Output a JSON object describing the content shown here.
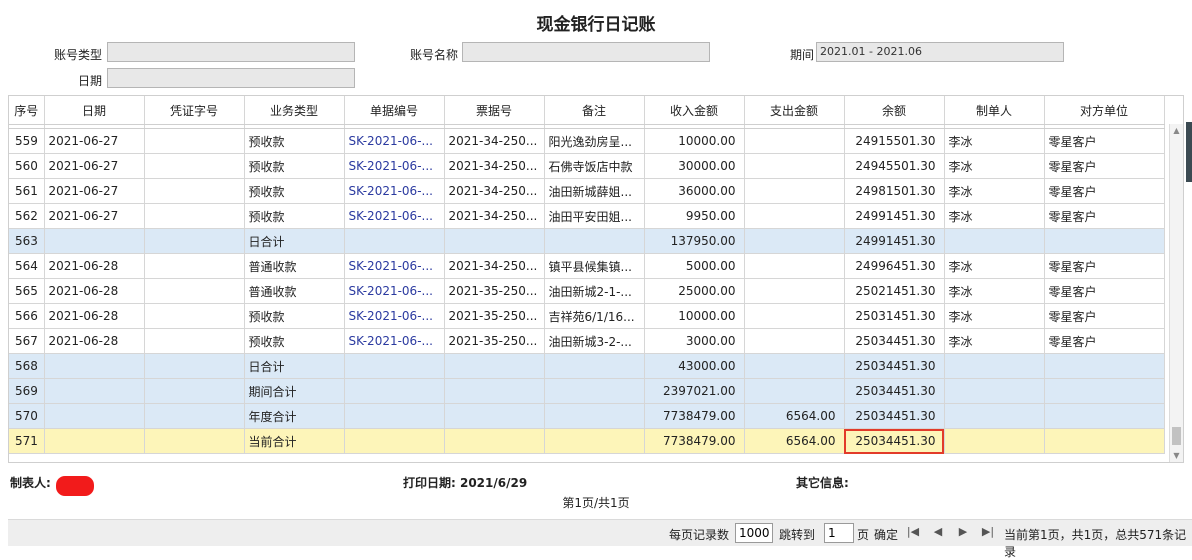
{
  "title": "现金银行日记账",
  "form": {
    "account_type_label": "账号类型",
    "account_type_value": "",
    "account_name_label": "账号名称",
    "account_name_value": "",
    "period_label": "期间",
    "period_value": "2021.01 - 2021.06",
    "date_label": "日期",
    "date_value": ""
  },
  "table": {
    "columns": [
      "序号",
      "日期",
      "凭证字号",
      "业务类型",
      "单据编号",
      "票据号",
      "备注",
      "收入金额",
      "支出金额",
      "余额",
      "制单人",
      "对方单位"
    ],
    "rows": [
      {
        "idx": "559",
        "date": "2021-06-27",
        "voucher": "",
        "biz": "预收款",
        "code": "SK-2021-06-...",
        "bill": "2021-34-250...",
        "note": "阳光逸劲房呈...",
        "income": "10000.00",
        "expense": "",
        "balance": "24915501.30",
        "maker": "李冰",
        "party": "零星客户",
        "type": "normal"
      },
      {
        "idx": "560",
        "date": "2021-06-27",
        "voucher": "",
        "biz": "预收款",
        "code": "SK-2021-06-...",
        "bill": "2021-34-250...",
        "note": "石佛寺饭店中款",
        "income": "30000.00",
        "expense": "",
        "balance": "24945501.30",
        "maker": "李冰",
        "party": "零星客户",
        "type": "normal"
      },
      {
        "idx": "561",
        "date": "2021-06-27",
        "voucher": "",
        "biz": "预收款",
        "code": "SK-2021-06-...",
        "bill": "2021-34-250...",
        "note": "油田新城薛姐...",
        "income": "36000.00",
        "expense": "",
        "balance": "24981501.30",
        "maker": "李冰",
        "party": "零星客户",
        "type": "normal"
      },
      {
        "idx": "562",
        "date": "2021-06-27",
        "voucher": "",
        "biz": "预收款",
        "code": "SK-2021-06-...",
        "bill": "2021-34-250...",
        "note": "油田平安田姐...",
        "income": "9950.00",
        "expense": "",
        "balance": "24991451.30",
        "maker": "李冰",
        "party": "零星客户",
        "type": "normal"
      },
      {
        "idx": "563",
        "date": "",
        "voucher": "",
        "biz": "日合计",
        "code": "",
        "bill": "",
        "note": "",
        "income": "137950.00",
        "expense": "",
        "balance": "24991451.30",
        "maker": "",
        "party": "",
        "type": "sum"
      },
      {
        "idx": "564",
        "date": "2021-06-28",
        "voucher": "",
        "biz": "普通收款",
        "code": "SK-2021-06-...",
        "bill": "2021-34-250...",
        "note": "镇平县候集镇...",
        "income": "5000.00",
        "expense": "",
        "balance": "24996451.30",
        "maker": "李冰",
        "party": "零星客户",
        "type": "normal"
      },
      {
        "idx": "565",
        "date": "2021-06-28",
        "voucher": "",
        "biz": "普通收款",
        "code": "SK-2021-06-...",
        "bill": "2021-35-250...",
        "note": "油田新城2-1-...",
        "income": "25000.00",
        "expense": "",
        "balance": "25021451.30",
        "maker": "李冰",
        "party": "零星客户",
        "type": "normal"
      },
      {
        "idx": "566",
        "date": "2021-06-28",
        "voucher": "",
        "biz": "预收款",
        "code": "SK-2021-06-...",
        "bill": "2021-35-250...",
        "note": "吉祥苑6/1/16...",
        "income": "10000.00",
        "expense": "",
        "balance": "25031451.30",
        "maker": "李冰",
        "party": "零星客户",
        "type": "normal"
      },
      {
        "idx": "567",
        "date": "2021-06-28",
        "voucher": "",
        "biz": "预收款",
        "code": "SK-2021-06-...",
        "bill": "2021-35-250...",
        "note": "油田新城3-2-...",
        "income": "3000.00",
        "expense": "",
        "balance": "25034451.30",
        "maker": "李冰",
        "party": "零星客户",
        "type": "normal"
      },
      {
        "idx": "568",
        "date": "",
        "voucher": "",
        "biz": "日合计",
        "code": "",
        "bill": "",
        "note": "",
        "income": "43000.00",
        "expense": "",
        "balance": "25034451.30",
        "maker": "",
        "party": "",
        "type": "sum"
      },
      {
        "idx": "569",
        "date": "",
        "voucher": "",
        "biz": "期间合计",
        "code": "",
        "bill": "",
        "note": "",
        "income": "2397021.00",
        "expense": "",
        "balance": "25034451.30",
        "maker": "",
        "party": "",
        "type": "sum"
      },
      {
        "idx": "570",
        "date": "",
        "voucher": "",
        "biz": "年度合计",
        "code": "",
        "bill": "",
        "note": "",
        "income": "7738479.00",
        "expense": "6564.00",
        "balance": "25034451.30",
        "maker": "",
        "party": "",
        "type": "sum"
      },
      {
        "idx": "571",
        "date": "",
        "voucher": "",
        "biz": "当前合计",
        "code": "",
        "bill": "",
        "note": "",
        "income": "7738479.00",
        "expense": "6564.00",
        "balance": "25034451.30",
        "maker": "",
        "party": "",
        "type": "cur"
      }
    ]
  },
  "footer": {
    "maker_label": "制表人:",
    "print_date_label": "打印日期: 2021/6/29",
    "other_info_label": "其它信息:",
    "page_info": "第1页/共1页"
  },
  "pager": {
    "per_page_label": "每页记录数",
    "per_page_value": "1000",
    "jump_label": "跳转到",
    "jump_value": "1",
    "page_unit": "页",
    "confirm_label": "确定",
    "status_text": "当前第1页，共1页，总共571条记录"
  },
  "colors": {
    "summary_row": "#dbe9f6",
    "current_row": "#fdf5b9",
    "highlight": "#e23b2a",
    "doc_code": "#2b3aa0"
  }
}
